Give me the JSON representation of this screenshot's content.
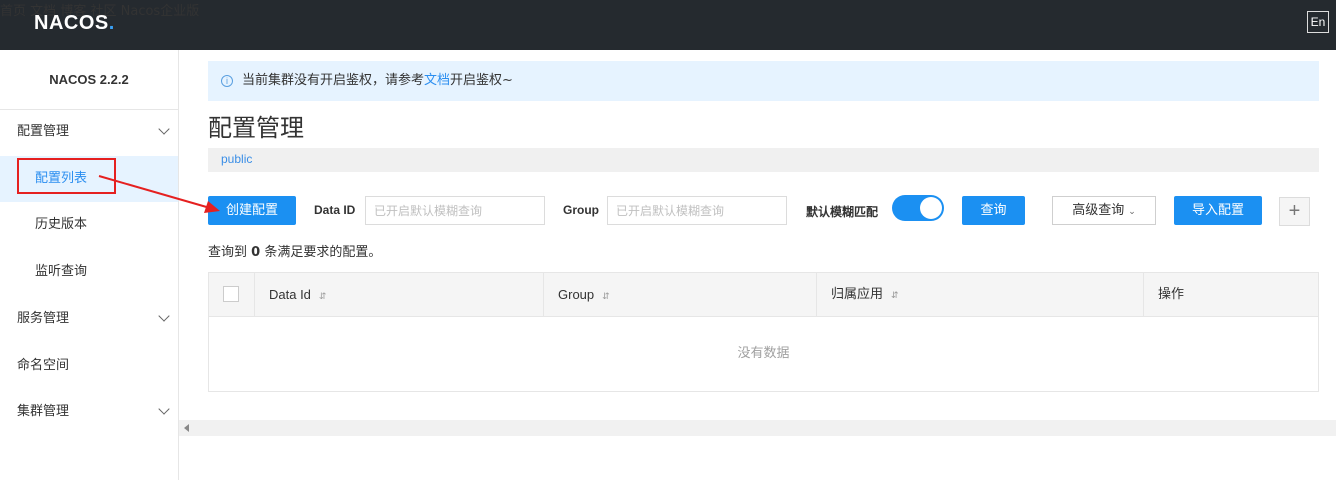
{
  "header": {
    "logo_main": "NACOS",
    "logo_dot": ".",
    "nav": [
      "首页",
      "文档",
      "博客",
      "社区",
      "Nacos企业版"
    ],
    "lang": "En"
  },
  "sidebar": {
    "version": "NACOS 2.2.2",
    "items": [
      {
        "label": "配置管理"
      },
      {
        "label": "配置列表"
      },
      {
        "label": "历史版本"
      },
      {
        "label": "监听查询"
      },
      {
        "label": "服务管理"
      },
      {
        "label": "命名空间"
      },
      {
        "label": "集群管理"
      }
    ]
  },
  "notice": {
    "prefix": "当前集群没有开启鉴权，请参考",
    "link": "文档",
    "suffix": "开启鉴权~"
  },
  "page": {
    "title": "配置管理",
    "namespace": "public"
  },
  "toolbar": {
    "create_label": "创建配置",
    "dataid_label": "Data ID",
    "dataid_placeholder": "已开启默认模糊查询",
    "group_label": "Group",
    "group_placeholder": "已开启默认模糊查询",
    "fuzzy_label": "默认模糊匹配",
    "fuzzy_on": true,
    "query_label": "查询",
    "advanced_label": "高级查询",
    "import_label": "导入配置",
    "plus": "+"
  },
  "result": {
    "prefix": "查询到",
    "count": "0",
    "suffix": "条满足要求的配置。"
  },
  "table": {
    "columns": [
      "Data Id",
      "Group",
      "归属应用",
      "操作"
    ],
    "empty_text": "没有数据"
  },
  "colors": {
    "accent": "#1b90f2",
    "topbar": "#252a2f",
    "annotation": "#e52020"
  }
}
